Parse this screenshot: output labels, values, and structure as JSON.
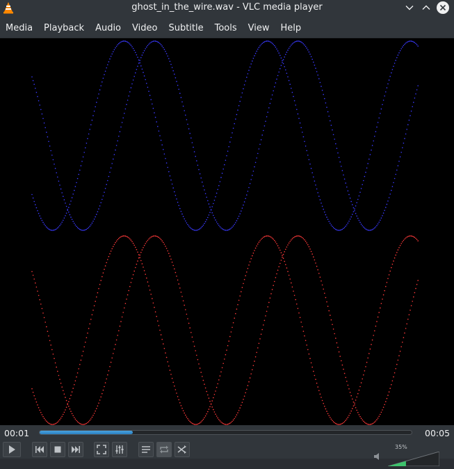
{
  "window": {
    "title": "ghost_in_the_wire.wav - VLC media player",
    "app_icon": "vlc-cone-icon",
    "controls": [
      "minimize-chevron-icon",
      "maximize-chevron-icon",
      "close-icon"
    ]
  },
  "menubar": {
    "items": [
      "Media",
      "Playback",
      "Audio",
      "Video",
      "Subtitle",
      "Tools",
      "View",
      "Help"
    ]
  },
  "visualization": {
    "description_hidden": "",
    "top_color": "#3a3aff",
    "bottom_color": "#ff3a3a"
  },
  "playback": {
    "elapsed": "00:01",
    "total": "00:05",
    "progress_fraction": 0.25
  },
  "toolbar": {
    "buttons": [
      {
        "name": "play-button",
        "icon": "play-icon"
      },
      {
        "name": "previous-button",
        "icon": "skip-back-icon"
      },
      {
        "name": "stop-button",
        "icon": "stop-icon"
      },
      {
        "name": "next-button",
        "icon": "skip-forward-icon"
      },
      {
        "name": "fullscreen-button",
        "icon": "fullscreen-icon"
      },
      {
        "name": "extended-settings-button",
        "icon": "equalizer-icon"
      },
      {
        "name": "playlist-button",
        "icon": "playlist-icon"
      },
      {
        "name": "loop-button",
        "icon": "loop-icon"
      },
      {
        "name": "shuffle-button",
        "icon": "shuffle-icon"
      }
    ]
  },
  "volume": {
    "label": "35%",
    "level_fraction": 0.35,
    "icon": "speaker-icon"
  },
  "colors": {
    "accent": "#3daee9",
    "background": "#31363b",
    "vlc_orange": "#ff8800"
  }
}
